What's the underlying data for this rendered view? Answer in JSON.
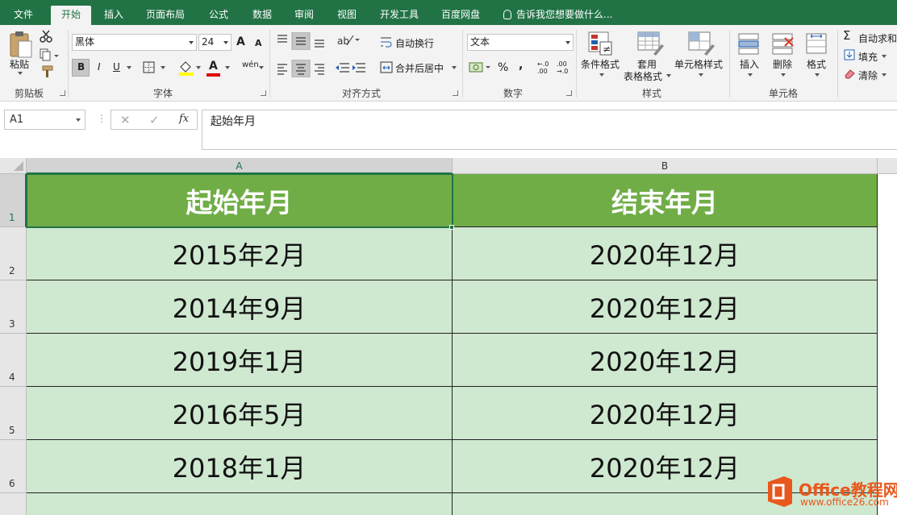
{
  "ribbon": {
    "tabs": [
      {
        "label": "文件",
        "active": false
      },
      {
        "label": "开始",
        "active": true
      },
      {
        "label": "插入",
        "active": false
      },
      {
        "label": "页面布局",
        "active": false
      },
      {
        "label": "公式",
        "active": false
      },
      {
        "label": "数据",
        "active": false
      },
      {
        "label": "审阅",
        "active": false
      },
      {
        "label": "视图",
        "active": false
      },
      {
        "label": "开发工具",
        "active": false
      },
      {
        "label": "百度网盘",
        "active": false
      }
    ],
    "tell_me": "告诉我您想要做什么...",
    "clipboard": {
      "paste": "粘贴",
      "group": "剪贴板"
    },
    "font": {
      "name": "黑体",
      "size": "24",
      "bold": "B",
      "italic": "I",
      "underline": "U",
      "font_color_letter": "A",
      "phonetic": "wén",
      "grow": "A",
      "shrink": "A",
      "group": "字体"
    },
    "alignment": {
      "wrap": "自动换行",
      "merge": "合并后居中",
      "group": "对齐方式"
    },
    "number": {
      "format": "文本",
      "percent": "%",
      "comma": ",",
      "inc_decimal": "←.0 .00",
      "dec_decimal": ".00 →.0",
      "group": "数字"
    },
    "styles": {
      "conditional": "条件格式",
      "table_1": "套用",
      "table_2": "表格格式",
      "cell_styles": "单元格样式",
      "group": "样式"
    },
    "cells": {
      "insert": "插入",
      "delete": "删除",
      "format": "格式",
      "group": "单元格"
    },
    "editing": {
      "autosum": "自动求和",
      "fill": "填充",
      "clear": "清除"
    }
  },
  "formula_bar": {
    "name_box": "A1",
    "cancel": "✕",
    "enter": "✓",
    "fx": "fx",
    "content": "起始年月"
  },
  "sheet": {
    "columns": [
      "A",
      "B"
    ],
    "selected_cell": "A1",
    "rows": [
      {
        "num": "1",
        "cells": [
          "起始年月",
          "结束年月"
        ]
      },
      {
        "num": "2",
        "cells": [
          "2015年2月",
          "2020年12月"
        ]
      },
      {
        "num": "3",
        "cells": [
          "2014年9月",
          "2020年12月"
        ]
      },
      {
        "num": "4",
        "cells": [
          "2019年1月",
          "2020年12月"
        ]
      },
      {
        "num": "5",
        "cells": [
          "2016年5月",
          "2020年12月"
        ]
      },
      {
        "num": "6",
        "cells": [
          "2018年1月",
          "2020年12月"
        ]
      }
    ]
  },
  "watermark": {
    "brand": "Office教程网",
    "url": "www.office26.com"
  },
  "colors": {
    "ribbon_green": "#217346",
    "header_fill": "#70ad47",
    "body_fill": "#cfe8d0",
    "watermark_orange": "#e8571c"
  }
}
